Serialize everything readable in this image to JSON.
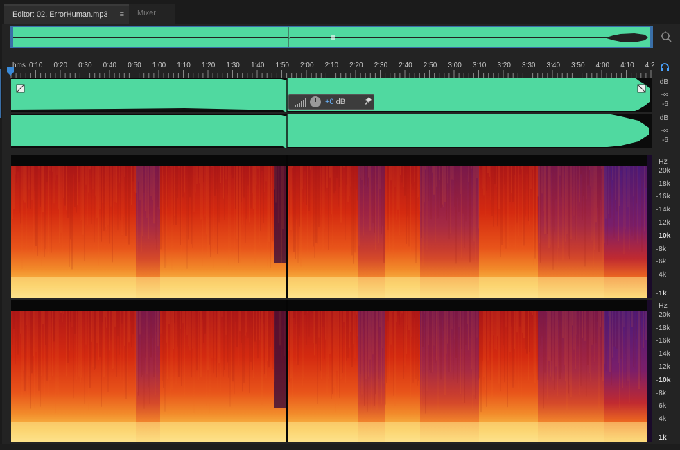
{
  "tabs": {
    "editor_label": "Editor: 02. ErrorHuman.mp3",
    "editor_menu": "≡",
    "mixer_label": "Mixer"
  },
  "ruler": {
    "unit": "hms",
    "labels": [
      "0:10",
      "0:20",
      "0:30",
      "0:40",
      "0:50",
      "1:00",
      "1:10",
      "1:20",
      "1:30",
      "1:40",
      "1:50",
      "2:00",
      "2:10",
      "2:20",
      "2:30",
      "2:40",
      "2:50",
      "3:00",
      "3:10",
      "3:20",
      "3:30",
      "3:40",
      "3:50",
      "4:00",
      "4:10",
      "4:2"
    ]
  },
  "waveform": {
    "db_unit": "dB",
    "db_inf": "-∞",
    "db_minus6": "-6",
    "hud_value": "+0",
    "hud_unit": "dB"
  },
  "spectral": {
    "unit": "Hz",
    "labels": [
      "20k",
      "18k",
      "16k",
      "14k",
      "12k",
      "10k",
      "8k",
      "6k",
      "4k",
      "1k"
    ]
  },
  "colors": {
    "waveform": "#50d9a0",
    "accent": "#3a6fa8",
    "hud_value": "#6ab4ff"
  },
  "icons": {
    "zoom": "zoom-magnifier-icon",
    "headphones": "headphones-icon",
    "pin": "pin-icon"
  }
}
